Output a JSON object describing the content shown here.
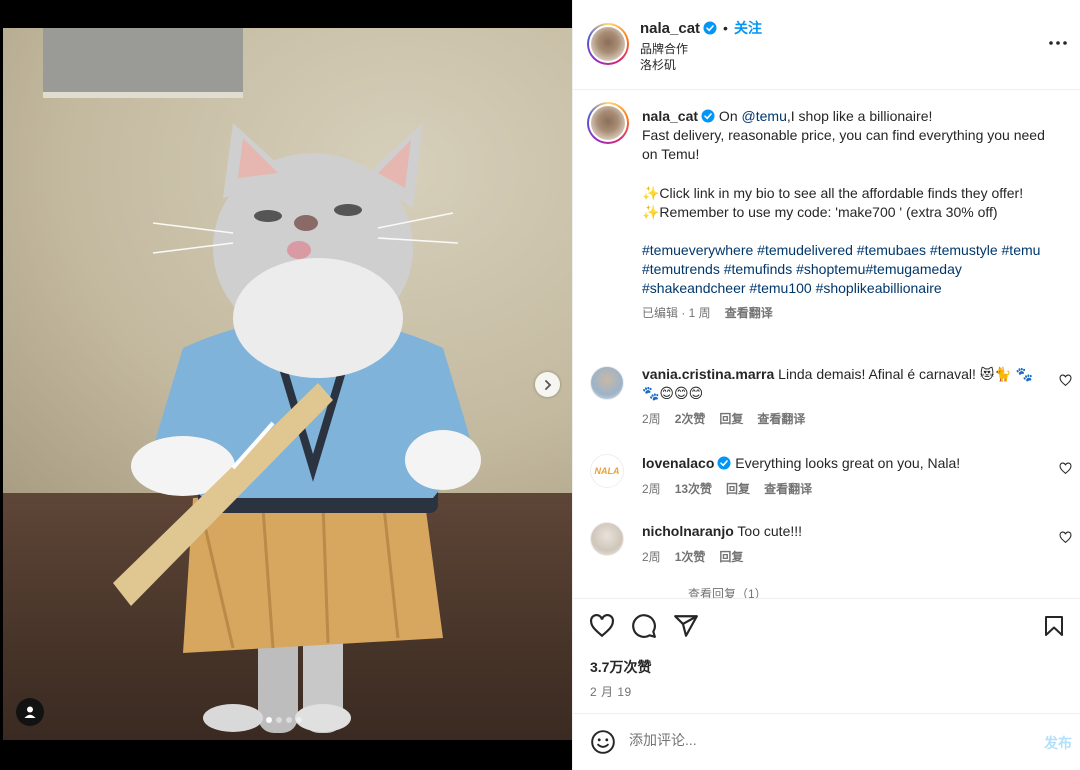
{
  "post": {
    "author": "nala_cat",
    "follow_label": "关注",
    "bullet": "•",
    "subtitle": "品牌合作",
    "location": "洛杉矶",
    "more_icon": "more-horizontal-icon",
    "image_count": 4,
    "active_image": 1
  },
  "caption": {
    "username": "nala_cat",
    "line1_pre": " On ",
    "mention": "@temu",
    "line1_post": ",I shop like a billionaire!",
    "line2": "Fast delivery, reasonable price, you can find everything you need on Temu!",
    "line3": "✨Click link in my bio to see all the affordable finds they offer!",
    "line4": "✨Remember to use my code: 'make700 ' (extra 30% off)",
    "hashtags": "#temueverywhere #temudelivered #temubaes #temustyle #temu #temutrends #temufinds #shoptemu#temugameday #shakeandcheer #temu100 #shoplikeabillionaire",
    "edited": "已编辑 · 1 周",
    "translate": "查看翻译"
  },
  "comments": [
    {
      "username": "vania.cristina.marra",
      "text": " Linda demais! Afinal é carnaval! 😻🐈 🐾🐾😊😊😊",
      "age": "2周",
      "likes": "2次赞",
      "reply": "回复",
      "translate": "查看翻译",
      "verified": false
    },
    {
      "username": "lovenalaco",
      "text": " Everything looks great on you, Nala!",
      "age": "2周",
      "likes": "13次赞",
      "reply": "回复",
      "translate": "查看翻译",
      "verified": true
    },
    {
      "username": "nicholnaranjo",
      "text": " Too cute!!!",
      "age": "2周",
      "likes": "1次赞",
      "reply": "回复",
      "verified": false
    }
  ],
  "more_replies": "查看回复（1）",
  "avatar_text": {
    "lovenala": "NALA"
  },
  "actions": {
    "likes_count": "3.7万次赞",
    "date": "2 月 19"
  },
  "composer": {
    "placeholder": "添加评论...",
    "post_label": "发布"
  },
  "colors": {
    "accent": "#0095f6",
    "link": "#00376b",
    "muted": "#737373",
    "post_disabled": "#b2dffc"
  }
}
